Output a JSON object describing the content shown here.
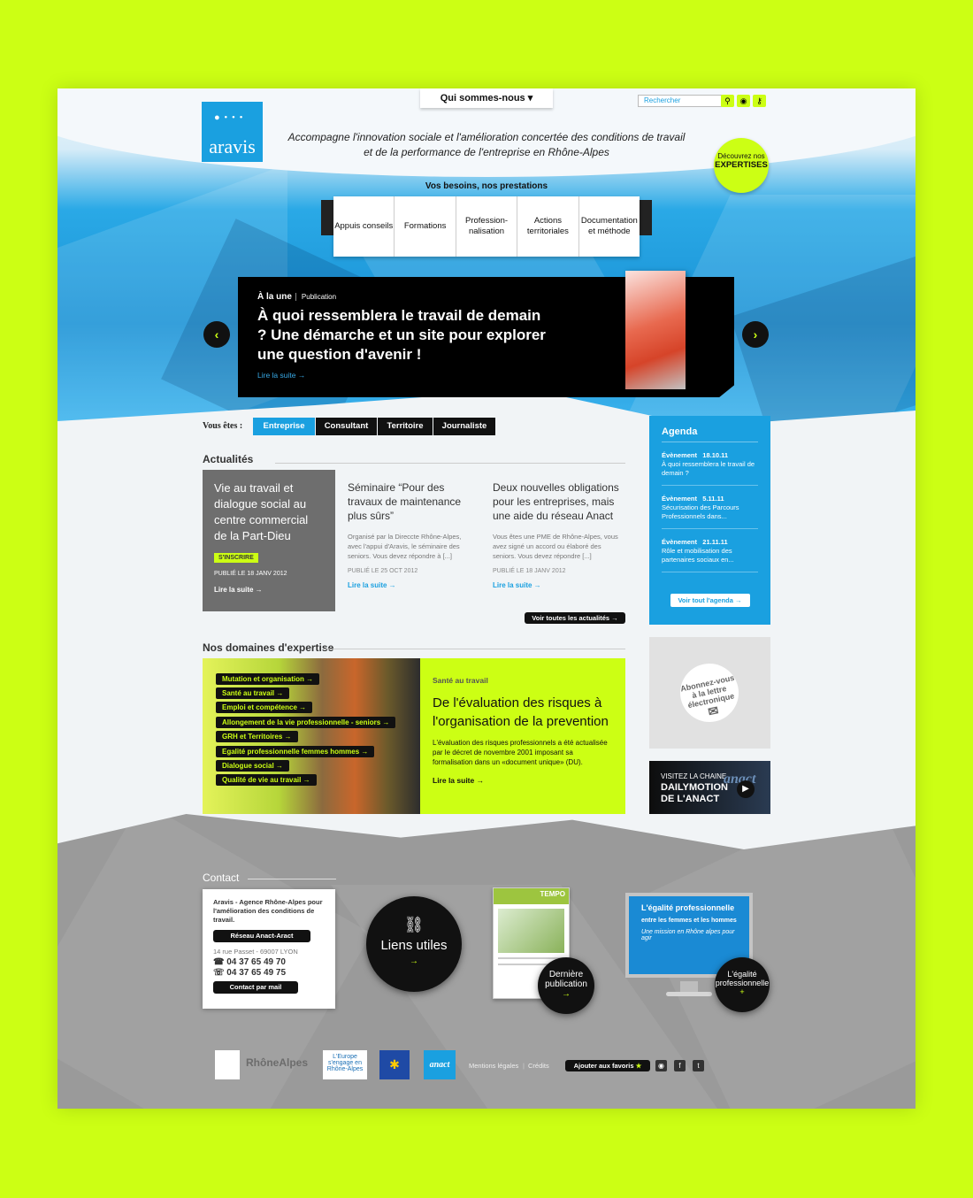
{
  "header": {
    "top_menu": "Qui sommes-nous",
    "search_placeholder": "Rechercher",
    "logo_text": "aravis",
    "tagline": "Accompagne l'innovation sociale et l'amélioration concertée des conditions de travail et de la performance de l'entreprise en Rhône-Alpes",
    "expertises_small": "Découvrez nos",
    "expertises_big": "EXPERTISES",
    "nav_title": "Vos besoins, nos prestations",
    "nav": [
      "Appuis conseils",
      "Formations",
      "Profession-nalisation",
      "Actions territoriales",
      "Documentation et méthode"
    ]
  },
  "hero": {
    "label": "À la une",
    "category": "Publication",
    "title": "À quoi ressemblera le travail de demain ? Une démarche et un site pour explorer une question d'avenir !",
    "more": "Lire la suite →"
  },
  "audience": {
    "label": "Vous êtes :",
    "tabs": [
      "Entreprise",
      "Consultant",
      "Territoire",
      "Journaliste"
    ],
    "active": "Entreprise"
  },
  "news": {
    "title": "Actualités",
    "featured": {
      "title": "Vie au travail et dialogue social au centre commercial de la Part-Dieu",
      "cta": "S'INSCRIRE",
      "date": "PUBLIÉ LE 18 JANV 2012",
      "more": "Lire la suite →"
    },
    "items": [
      {
        "title": "Séminaire “Pour des travaux de maintenance plus sûrs”",
        "desc": "Organisé par la Direccte Rhône-Alpes, avec l'appui d'Aravis, le séminaire des seniors. Vous devez répondre à [...]",
        "date": "PUBLIÉ LE 25 OCT 2012",
        "more": "Lire la suite →"
      },
      {
        "title": "Deux nouvelles obligations pour les entreprises, mais une aide du réseau Anact",
        "desc": "Vous êtes une PME de Rhône-Alpes, vous avez signé un accord ou élaboré des seniors. Vous devez répondre [...]",
        "date": "PUBLIÉ LE 18 JANV 2012",
        "more": "Lire la suite →"
      }
    ],
    "all": "Voir toutes les actualités →"
  },
  "agenda": {
    "title": "Agenda",
    "events": [
      {
        "type": "Évènement",
        "date": "18.10.11",
        "text": "À quoi ressemblera le travail de demain ?"
      },
      {
        "type": "Évènement",
        "date": "5.11.11",
        "text": "Sécurisation des Parcours Professionnels dans..."
      },
      {
        "type": "Évènement",
        "date": "21.11.11",
        "text": "Rôle et mobilisation des partenaires sociaux en..."
      }
    ],
    "all": "Voir tout l'agenda →"
  },
  "newsletter": "Abonnez-vous à la lettre électronique",
  "dailymotion": {
    "line1": "VISITEZ LA CHAINE",
    "line2": "DAILYMOTION",
    "line3": "DE L'ANACT",
    "logo": "anact"
  },
  "expertise": {
    "title": "Nos domaines d'expertise",
    "items": [
      "Mutation et organisation →",
      "Santé au travail →",
      "Emploi et compétence →",
      "Allongement de la vie professionnelle - seniors →",
      "GRH et Territoires →",
      "Egalité professionnelle femmes hommes →",
      "Dialogue social →",
      "Qualité de vie au travail →"
    ],
    "feature": {
      "kicker": "Santé au travail",
      "title": "De l'évaluation des risques à l'organisation de la prevention",
      "desc": "L'évaluation des risques professionnels a été actualisée par le décret de novembre 2001 imposant sa formalisation dans un «document unique» (DU).",
      "more": "Lire la suite →"
    }
  },
  "footer": {
    "contact_title": "Contact",
    "org": "Aravis - Agence Rhône-Alpes pour l'amélioration des conditions de travail.",
    "network": "Réseau Anact-Aract",
    "address": "14 rue Passet - 69007 LYON",
    "phone": "04 37 65 49 70",
    "fax": "04 37 65 49 75",
    "mail": "Contact par mail",
    "liens": "Liens utiles",
    "tempo_title": "TEMPO",
    "derniere": "Dernière publication",
    "egalite_screen": "L'égalité professionnelle",
    "egalite_sub": "entre les femmes et les hommes",
    "egalite_mission": "Une mission en Rhône alpes pour agir",
    "egalite_btn": "L'égalité professionnelle",
    "logos": [
      "RhôneAlpes",
      "L'Europe s'engage en Rhône-Alpes",
      "anact"
    ],
    "mentions": "Mentions légales",
    "credits": "Crédits",
    "favoris": "Ajouter aux favoris"
  },
  "colors": {
    "accent": "#ccff14",
    "blue": "#1aa0e0",
    "dark": "#111111"
  }
}
